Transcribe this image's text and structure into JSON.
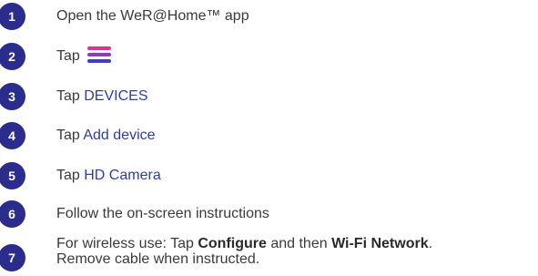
{
  "steps": [
    {
      "number": "1",
      "text": "Open the WeR@Home™ app"
    },
    {
      "number": "2",
      "tap": "Tap"
    },
    {
      "number": "3",
      "tap": "Tap",
      "keyword": "DEVICES"
    },
    {
      "number": "4",
      "tap": "Tap",
      "keyword": "Add device"
    },
    {
      "number": "5",
      "tap": "Tap",
      "keyword": "HD Camera"
    },
    {
      "number": "6",
      "text": "Follow the on-screen instructions"
    },
    {
      "number": "7",
      "line1_prefix": "For wireless use: Tap",
      "line1_bold1": "Configure",
      "line1_mid": "and then",
      "line1_bold2": "Wi-Fi Network",
      "line1_end": ".",
      "line2": "Remove cable when instructed."
    }
  ],
  "menu_icon": {
    "name": "hamburger-menu-icon",
    "colors": [
      "#e0338d",
      "#8a3fb3",
      "#3d3fc0"
    ]
  },
  "colors": {
    "badge": "#2b2c8c",
    "keyword": "#2d3ea8",
    "text": "#3a3a3a"
  }
}
